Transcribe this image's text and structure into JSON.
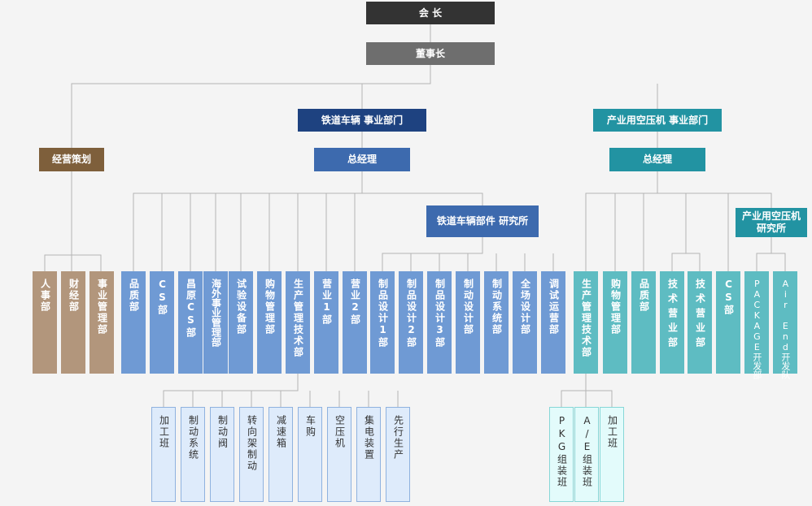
{
  "top": {
    "chairman": "会 长",
    "president": "董事长"
  },
  "planning": {
    "title": "经营策划"
  },
  "planning_depts": [
    "人事部",
    "财经部",
    "事业管理部"
  ],
  "rail": {
    "title": "铁道车辆 事业部门",
    "gm": "总经理",
    "depts": [
      "品质部",
      "CS部",
      "昌原CS部",
      "海外事业管理部",
      "试验设备部",
      "购物管理部",
      "生产管理技术部",
      "营业1部",
      "营业2部"
    ],
    "institute": "铁道车辆部件 研究所",
    "institute_depts": [
      "制品设计1部",
      "制品设计2部",
      "制品设计3部",
      "制动设计部",
      "制动系统部",
      "全场设计部",
      "调试运营部"
    ],
    "production_teams": [
      "加工班",
      "制动系统",
      "制动阀",
      "转向架制动",
      "减速箱",
      "车购",
      "空压机",
      "集电装置",
      "先行生产"
    ]
  },
  "compressor": {
    "title": "产业用空压机 事业部门",
    "gm": "总经理",
    "depts": [
      "生产管理技术部",
      "购物管理部",
      "品质部",
      "技术营业部",
      "技术营业部",
      "CS部"
    ],
    "institute": "产业用空压机 研究所",
    "institute_depts": [
      "PACKAGE开发部",
      "Air End开发队"
    ],
    "production_teams": [
      "PKG组装班",
      "A/E组装班",
      "加工班"
    ]
  }
}
